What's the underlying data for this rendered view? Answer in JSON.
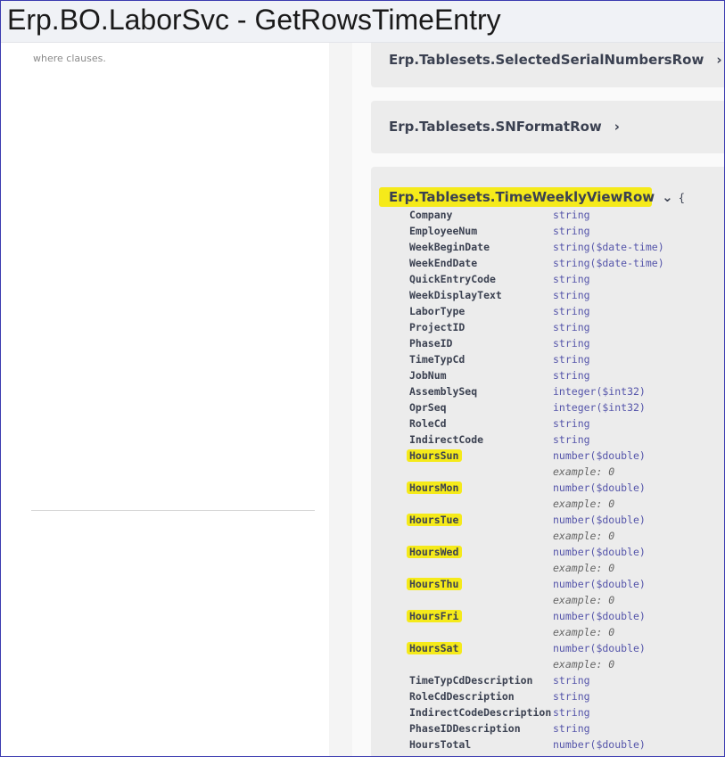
{
  "title": "Erp.BO.LaborSvc - GetRowsTimeEntry",
  "left": {
    "description_fragment": "where clauses."
  },
  "models": [
    {
      "name": "Erp.Tablesets.SelectedSerialNumbersRow",
      "chevron": "›"
    },
    {
      "name": "Erp.Tablesets.SNFormatRow",
      "chevron": "›"
    }
  ],
  "expanded_model": {
    "name": "Erp.Tablesets.TimeWeeklyViewRow",
    "chevron": "⌄",
    "brace": "{",
    "properties": [
      {
        "name": "Company",
        "type": "string"
      },
      {
        "name": "EmployeeNum",
        "type": "string"
      },
      {
        "name": "WeekBeginDate",
        "type": "string($date-time)"
      },
      {
        "name": "WeekEndDate",
        "type": "string($date-time)"
      },
      {
        "name": "QuickEntryCode",
        "type": "string"
      },
      {
        "name": "WeekDisplayText",
        "type": "string"
      },
      {
        "name": "LaborType",
        "type": "string"
      },
      {
        "name": "ProjectID",
        "type": "string"
      },
      {
        "name": "PhaseID",
        "type": "string"
      },
      {
        "name": "TimeTypCd",
        "type": "string"
      },
      {
        "name": "JobNum",
        "type": "string"
      },
      {
        "name": "AssemblySeq",
        "type": "integer($int32)"
      },
      {
        "name": "OprSeq",
        "type": "integer($int32)"
      },
      {
        "name": "RoleCd",
        "type": "string"
      },
      {
        "name": "IndirectCode",
        "type": "string"
      },
      {
        "name": "HoursSun",
        "type": "number($double)",
        "example": "example: 0",
        "highlighted": true
      },
      {
        "name": "HoursMon",
        "type": "number($double)",
        "example": "example: 0",
        "highlighted": true
      },
      {
        "name": "HoursTue",
        "type": "number($double)",
        "example": "example: 0",
        "highlighted": true
      },
      {
        "name": "HoursWed",
        "type": "number($double)",
        "example": "example: 0",
        "highlighted": true
      },
      {
        "name": "HoursThu",
        "type": "number($double)",
        "example": "example: 0",
        "highlighted": true
      },
      {
        "name": "HoursFri",
        "type": "number($double)",
        "example": "example: 0",
        "highlighted": true
      },
      {
        "name": "HoursSat",
        "type": "number($double)",
        "example": "example: 0",
        "highlighted": true
      },
      {
        "name": "TimeTypCdDescription",
        "type": "string"
      },
      {
        "name": "RoleCdDescription",
        "type": "string"
      },
      {
        "name": "IndirectCodeDescription",
        "type": "string"
      },
      {
        "name": "PhaseIDDescription",
        "type": "string"
      },
      {
        "name": "HoursTotal",
        "type": "number($double)"
      }
    ]
  },
  "colors": {
    "highlight": "#f5ea1a",
    "type_text": "#5555aa",
    "title_text": "#3b4151"
  }
}
